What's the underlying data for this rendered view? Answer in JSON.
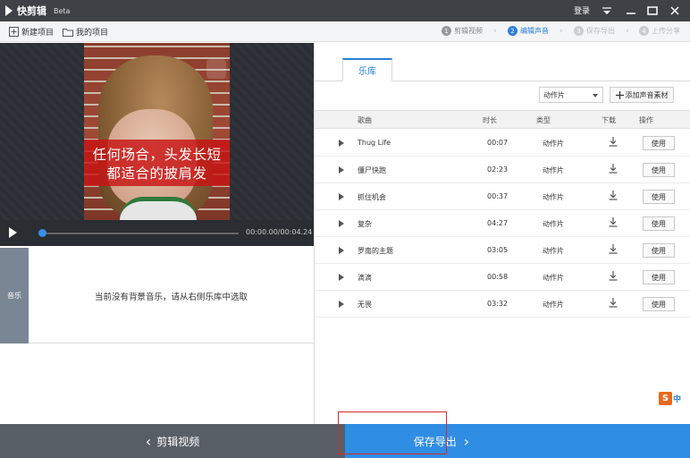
{
  "titlebar": {
    "app_name": "快剪辑",
    "beta": "Beta",
    "login": "登录",
    "icons": [
      "menu-icon",
      "minimize-icon",
      "maximize-icon",
      "close-icon"
    ]
  },
  "toolbar": {
    "new_project": "新建项目",
    "my_projects": "我的项目",
    "steps": [
      {
        "num": "1",
        "label": "剪辑视频",
        "state": "done"
      },
      {
        "num": "2",
        "label": "编辑声音",
        "state": "active"
      },
      {
        "num": "3",
        "label": "保存导出",
        "state": "inactive"
      },
      {
        "num": "4",
        "label": "上传分享",
        "state": "inactive"
      }
    ]
  },
  "preview": {
    "subtitle_line1": "任何场合，头发长短",
    "subtitle_line2": "都适合的披肩发",
    "time": "00:00.00/00:04.24",
    "progress": 0
  },
  "music": {
    "tag": "音乐",
    "empty_message": "当前没有背景音乐，请从右侧乐库中选取"
  },
  "library": {
    "tab": "乐库",
    "category": "动作片",
    "add_button": "添加声音素材",
    "columns": [
      "歌曲",
      "时长",
      "类型",
      "下载",
      "操作"
    ],
    "rows": [
      {
        "name": "Thug Life",
        "duration": "00:07",
        "type": "动作片",
        "action": "使用"
      },
      {
        "name": "僵尸快跑",
        "duration": "02:23",
        "type": "动作片",
        "action": "使用"
      },
      {
        "name": "抓住机会",
        "duration": "00:37",
        "type": "动作片",
        "action": "使用"
      },
      {
        "name": "复杂",
        "duration": "04:27",
        "type": "动作片",
        "action": "使用"
      },
      {
        "name": "罗南的主题",
        "duration": "03:05",
        "type": "动作片",
        "action": "使用"
      },
      {
        "name": "滴滴",
        "duration": "00:58",
        "type": "动作片",
        "action": "使用"
      },
      {
        "name": "无畏",
        "duration": "03:32",
        "type": "动作片",
        "action": "使用"
      }
    ]
  },
  "ime": {
    "logo": "S",
    "lang": "中"
  },
  "bottom": {
    "back_label": "剪辑视频",
    "save_label": "保存导出"
  },
  "colors": {
    "accent": "#2f8de4",
    "highlight": "#d9262c",
    "titlebar": "#3e4247"
  }
}
